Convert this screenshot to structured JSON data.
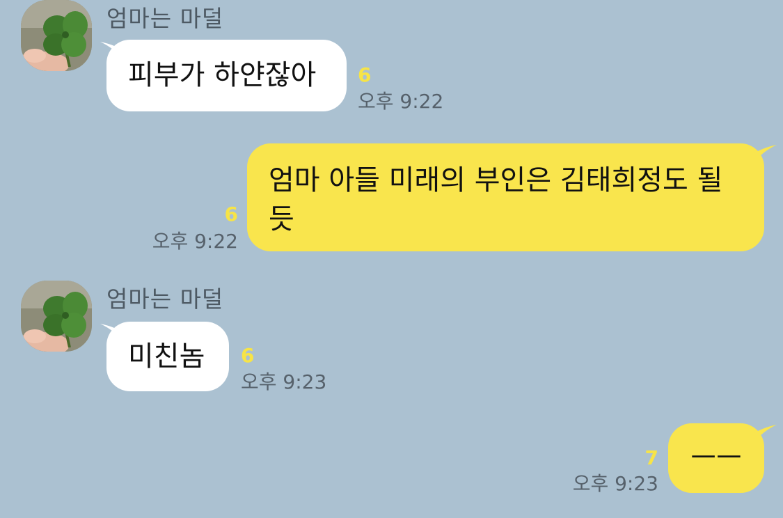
{
  "conversation": {
    "messages": [
      {
        "direction": "incoming",
        "sender": "엄마는 마덜",
        "text": "피부가 하얀잖아",
        "unread": "6",
        "time": "오후 9:22"
      },
      {
        "direction": "outgoing",
        "text": "엄마 아들 미래의 부인은 김태희정도 될 듯",
        "unread": "6",
        "time": "오후 9:22"
      },
      {
        "direction": "incoming",
        "sender": "엄마는 마덜",
        "text": "미친놈",
        "unread": "6",
        "time": "오후 9:23"
      },
      {
        "direction": "outgoing",
        "text": "ㅡㅡ",
        "unread": "7",
        "time": "오후 9:23"
      }
    ]
  },
  "colors": {
    "background": "#abc1d1",
    "incoming_bubble": "#ffffff",
    "outgoing_bubble": "#f9e54d",
    "unread_count": "#f7e447",
    "meta_text": "#56616b"
  },
  "icons": {
    "avatar": "four-leaf-clover-photo"
  }
}
